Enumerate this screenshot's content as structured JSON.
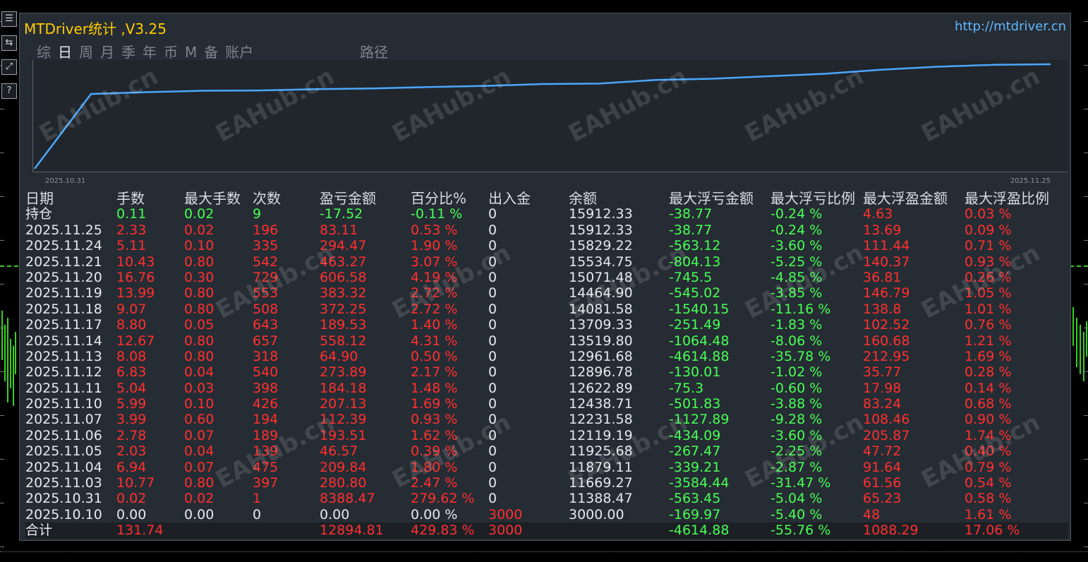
{
  "window": {
    "title": "MTDriver统计 ,V3.25",
    "url_text": "http://mtdriver.cn"
  },
  "tabs": [
    "综",
    "日",
    "周",
    "月",
    "季",
    "年",
    "币",
    "M",
    "备",
    "账户"
  ],
  "active_tab": "日",
  "path_tab": "路径",
  "chart": {
    "start_date": "2025.10.31",
    "end_date": "2025.11.25",
    "line_color": "#4aa8ff",
    "points": [
      0,
      11388.47,
      11669.27,
      11879.11,
      11925.68,
      12119.19,
      12231.58,
      12438.71,
      12622.89,
      12896.78,
      12961.68,
      13519.8,
      13709.33,
      14081.58,
      14464.9,
      15071.48,
      15534.75,
      15829.22,
      15912.33
    ]
  },
  "table": {
    "headers": [
      "日期",
      "手数",
      "最大手数",
      "次数",
      "盈亏金额",
      "百分比%",
      "出入金",
      "余额",
      "最大浮亏金额",
      "最大浮亏比例",
      "最大浮盈金额",
      "最大浮盈比例"
    ],
    "rows": [
      {
        "date": "持仓",
        "lots": "0.11",
        "maxlots": "0.02",
        "count": "9",
        "pl": "-17.52",
        "pct": "-0.11 %",
        "io": "0",
        "bal": "15912.33",
        "mfl": "-38.77",
        "mflp": "-0.24 %",
        "mfp": "4.63",
        "mfpp": "0.03 %",
        "color": "g"
      },
      {
        "date": "2025.11.25",
        "lots": "2.33",
        "maxlots": "0.02",
        "count": "196",
        "pl": "83.11",
        "pct": "0.53 %",
        "io": "0",
        "bal": "15912.33",
        "mfl": "-38.77",
        "mflp": "-0.24 %",
        "mfp": "13.69",
        "mfpp": "0.09 %",
        "color": "r"
      },
      {
        "date": "2025.11.24",
        "lots": "5.11",
        "maxlots": "0.10",
        "count": "335",
        "pl": "294.47",
        "pct": "1.90 %",
        "io": "0",
        "bal": "15829.22",
        "mfl": "-563.12",
        "mflp": "-3.60 %",
        "mfp": "111.44",
        "mfpp": "0.71 %",
        "color": "r"
      },
      {
        "date": "2025.11.21",
        "lots": "10.43",
        "maxlots": "0.80",
        "count": "542",
        "pl": "463.27",
        "pct": "3.07 %",
        "io": "0",
        "bal": "15534.75",
        "mfl": "-804.13",
        "mflp": "-5.25 %",
        "mfp": "140.37",
        "mfpp": "0.93 %",
        "color": "r"
      },
      {
        "date": "2025.11.20",
        "lots": "16.76",
        "maxlots": "0.30",
        "count": "729",
        "pl": "606.58",
        "pct": "4.19 %",
        "io": "0",
        "bal": "15071.48",
        "mfl": "-745.5",
        "mflp": "-4.85 %",
        "mfp": "36.81",
        "mfpp": "0.26 %",
        "color": "r"
      },
      {
        "date": "2025.11.19",
        "lots": "13.99",
        "maxlots": "0.80",
        "count": "553",
        "pl": "383.32",
        "pct": "2.72 %",
        "io": "0",
        "bal": "14464.90",
        "mfl": "-545.02",
        "mflp": "-3.85 %",
        "mfp": "146.79",
        "mfpp": "1.05 %",
        "color": "r"
      },
      {
        "date": "2025.11.18",
        "lots": "9.07",
        "maxlots": "0.80",
        "count": "508",
        "pl": "372.25",
        "pct": "2.72 %",
        "io": "0",
        "bal": "14081.58",
        "mfl": "-1540.15",
        "mflp": "-11.16 %",
        "mfp": "138.8",
        "mfpp": "1.01 %",
        "color": "r"
      },
      {
        "date": "2025.11.17",
        "lots": "8.80",
        "maxlots": "0.05",
        "count": "643",
        "pl": "189.53",
        "pct": "1.40 %",
        "io": "0",
        "bal": "13709.33",
        "mfl": "-251.49",
        "mflp": "-1.83 %",
        "mfp": "102.52",
        "mfpp": "0.76 %",
        "color": "r"
      },
      {
        "date": "2025.11.14",
        "lots": "12.67",
        "maxlots": "0.80",
        "count": "657",
        "pl": "558.12",
        "pct": "4.31 %",
        "io": "0",
        "bal": "13519.80",
        "mfl": "-1064.48",
        "mflp": "-8.06 %",
        "mfp": "160.68",
        "mfpp": "1.21 %",
        "color": "r"
      },
      {
        "date": "2025.11.13",
        "lots": "8.08",
        "maxlots": "0.80",
        "count": "318",
        "pl": "64.90",
        "pct": "0.50 %",
        "io": "0",
        "bal": "12961.68",
        "mfl": "-4614.88",
        "mflp": "-35.78 %",
        "mfp": "212.95",
        "mfpp": "1.69 %",
        "color": "r"
      },
      {
        "date": "2025.11.12",
        "lots": "6.83",
        "maxlots": "0.04",
        "count": "540",
        "pl": "273.89",
        "pct": "2.17 %",
        "io": "0",
        "bal": "12896.78",
        "mfl": "-130.01",
        "mflp": "-1.02 %",
        "mfp": "35.77",
        "mfpp": "0.28 %",
        "color": "r"
      },
      {
        "date": "2025.11.11",
        "lots": "5.04",
        "maxlots": "0.03",
        "count": "398",
        "pl": "184.18",
        "pct": "1.48 %",
        "io": "0",
        "bal": "12622.89",
        "mfl": "-75.3",
        "mflp": "-0.60 %",
        "mfp": "17.98",
        "mfpp": "0.14 %",
        "color": "r"
      },
      {
        "date": "2025.11.10",
        "lots": "5.99",
        "maxlots": "0.10",
        "count": "426",
        "pl": "207.13",
        "pct": "1.69 %",
        "io": "0",
        "bal": "12438.71",
        "mfl": "-501.83",
        "mflp": "-3.88 %",
        "mfp": "83.24",
        "mfpp": "0.68 %",
        "color": "r"
      },
      {
        "date": "2025.11.07",
        "lots": "3.99",
        "maxlots": "0.60",
        "count": "194",
        "pl": "112.39",
        "pct": "0.93 %",
        "io": "0",
        "bal": "12231.58",
        "mfl": "-1127.89",
        "mflp": "-9.28 %",
        "mfp": "108.46",
        "mfpp": "0.90 %",
        "color": "r"
      },
      {
        "date": "2025.11.06",
        "lots": "2.78",
        "maxlots": "0.07",
        "count": "189",
        "pl": "193.51",
        "pct": "1.62 %",
        "io": "0",
        "bal": "12119.19",
        "mfl": "-434.09",
        "mflp": "-3.60 %",
        "mfp": "205.87",
        "mfpp": "1.74 %",
        "color": "r"
      },
      {
        "date": "2025.11.05",
        "lots": "2.03",
        "maxlots": "0.04",
        "count": "139",
        "pl": "46.57",
        "pct": "0.39 %",
        "io": "0",
        "bal": "11925.68",
        "mfl": "-267.47",
        "mflp": "-2.25 %",
        "mfp": "47.72",
        "mfpp": "0.40 %",
        "color": "r"
      },
      {
        "date": "2025.11.04",
        "lots": "6.94",
        "maxlots": "0.07",
        "count": "475",
        "pl": "209.84",
        "pct": "1.80 %",
        "io": "0",
        "bal": "11879.11",
        "mfl": "-339.21",
        "mflp": "-2.87 %",
        "mfp": "91.64",
        "mfpp": "0.79 %",
        "color": "r"
      },
      {
        "date": "2025.11.03",
        "lots": "10.77",
        "maxlots": "0.80",
        "count": "397",
        "pl": "280.80",
        "pct": "2.47 %",
        "io": "0",
        "bal": "11669.27",
        "mfl": "-3584.44",
        "mflp": "-31.47 %",
        "mfp": "61.56",
        "mfpp": "0.54 %",
        "color": "r"
      },
      {
        "date": "2025.10.31",
        "lots": "0.02",
        "maxlots": "0.02",
        "count": "1",
        "pl": "8388.47",
        "pct": "279.62 %",
        "io": "0",
        "bal": "11388.47",
        "mfl": "-563.45",
        "mflp": "-5.04 %",
        "mfp": "65.23",
        "mfpp": "0.58 %",
        "color": "r"
      },
      {
        "date": "2025.10.10",
        "lots": "0.00",
        "maxlots": "0.00",
        "count": "0",
        "pl": "0.00",
        "pct": "0.00 %",
        "io": "3000",
        "bal": "3000.00",
        "mfl": "-169.97",
        "mflp": "-5.40 %",
        "mfp": "48",
        "mfpp": "1.61 %",
        "color": "w"
      }
    ],
    "total": {
      "label": "合计",
      "lots": "131.74",
      "pl": "12894.81",
      "pct": "429.83 %",
      "io": "3000",
      "mfl": "-4614.88",
      "mflp": "-55.76 %",
      "mfp": "1088.29",
      "mfpp": "17.06 %"
    }
  },
  "watermark": "EAHub.cn",
  "side_buttons": [
    "☰",
    "⇆",
    "⤢",
    "?"
  ]
}
